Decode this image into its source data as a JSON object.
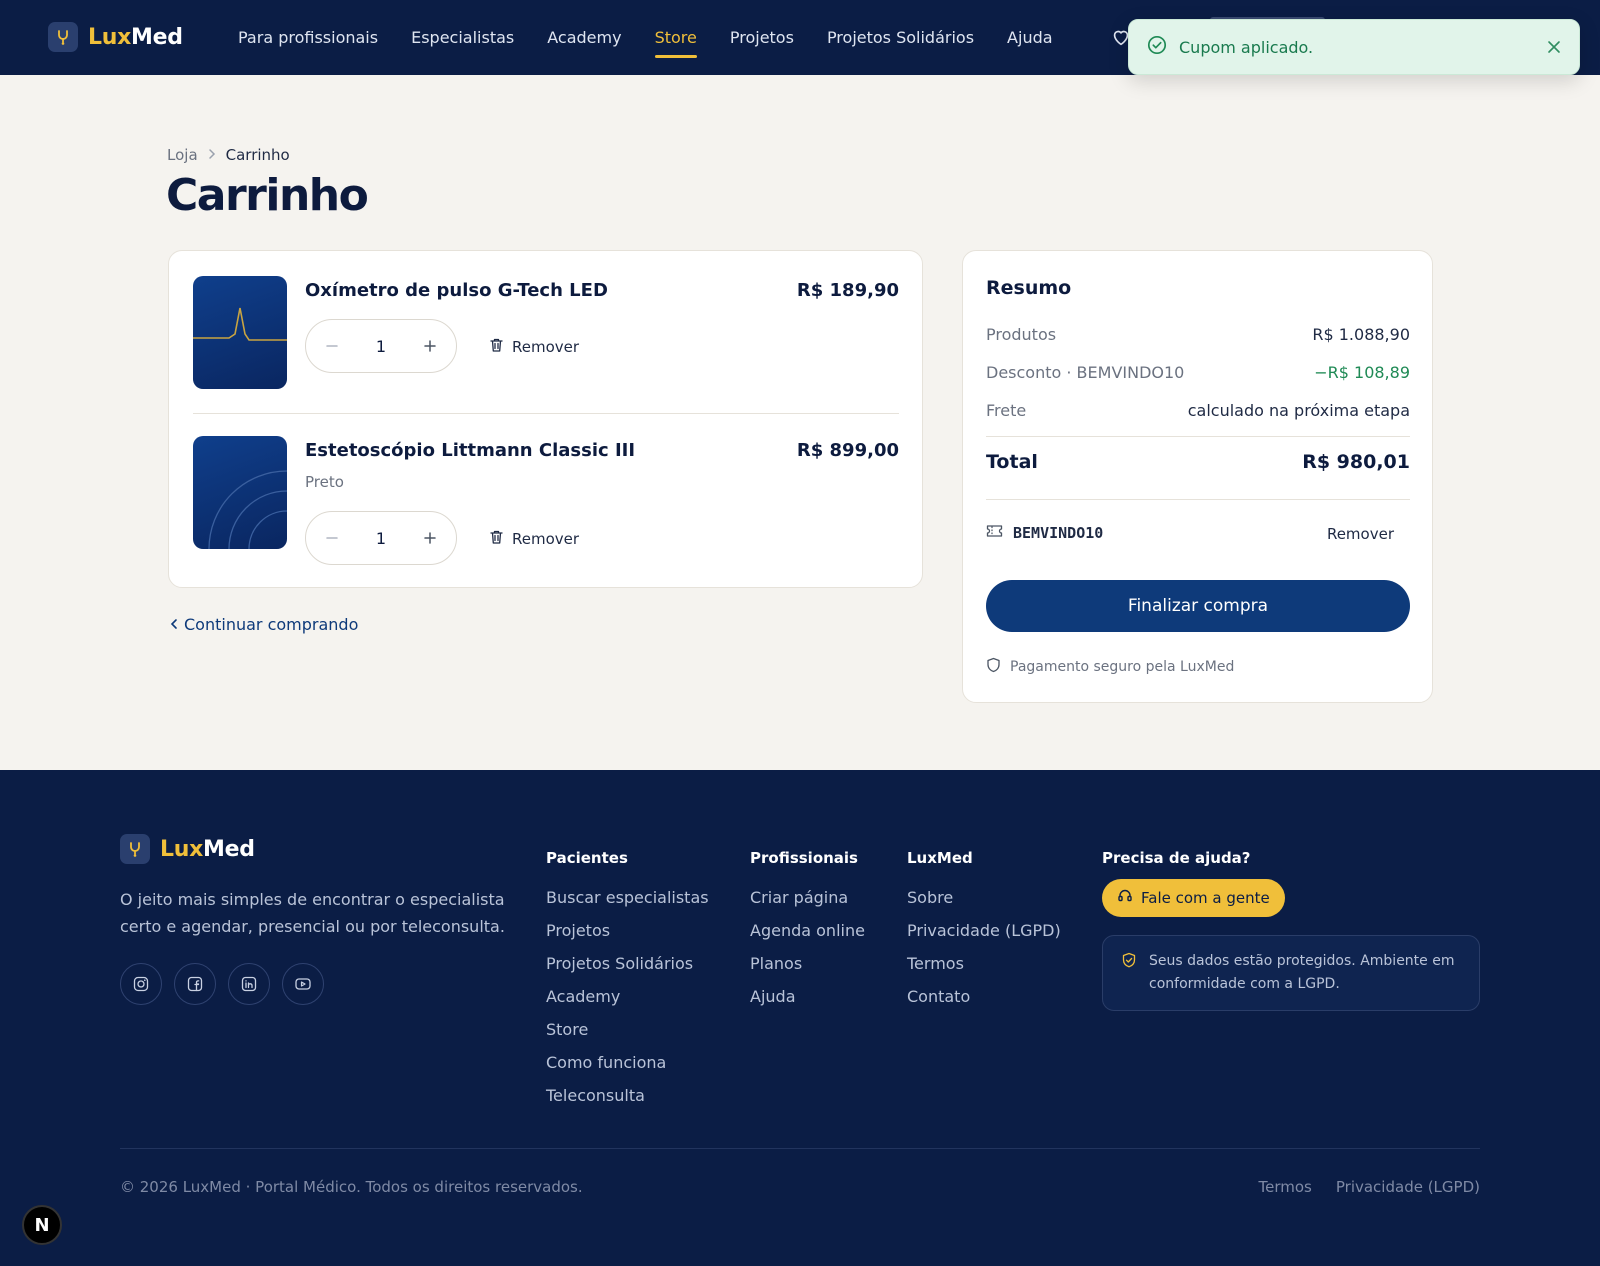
{
  "brand": {
    "lux": "Lux",
    "med": "Med"
  },
  "nav": {
    "items": [
      {
        "label": "Para profissionais"
      },
      {
        "label": "Especialistas"
      },
      {
        "label": "Academy"
      },
      {
        "label": "Store",
        "active": true
      },
      {
        "label": "Projetos"
      },
      {
        "label": "Projetos Solidários"
      },
      {
        "label": "Ajuda"
      }
    ]
  },
  "toast": {
    "message": "Cupom aplicado.",
    "icon": "check-circle-icon"
  },
  "breadcrumb": {
    "parent": "Loja",
    "current": "Carrinho"
  },
  "page": {
    "title": "Carrinho"
  },
  "cart": {
    "items": [
      {
        "name": "Oxímetro de pulso G-Tech LED",
        "price": "R$ 189,90",
        "variant": "",
        "quantity": "1",
        "remove_label": "Remover"
      },
      {
        "name": "Estetoscópio Littmann Classic III",
        "price": "R$ 899,00",
        "variant": "Preto",
        "quantity": "1",
        "remove_label": "Remover"
      }
    ],
    "continue_label": "Continuar comprando"
  },
  "summary": {
    "title": "Resumo",
    "products_label": "Produtos",
    "products_value": "R$ 1.088,90",
    "discount_label": "Desconto · BEMVINDO10",
    "discount_value": "−R$ 108,89",
    "shipping_label": "Frete",
    "shipping_value": "calculado na próxima etapa",
    "total_label": "Total",
    "total_value": "R$ 980,01",
    "coupon_code": "BEMVINDO10",
    "coupon_remove": "Remover",
    "checkout_label": "Finalizar compra",
    "secure_note": "Pagamento seguro pela LuxMed"
  },
  "footer": {
    "tagline": "O jeito mais simples de encontrar o especialista certo e agendar, presencial ou por teleconsulta.",
    "socials": [
      "instagram-icon",
      "facebook-icon",
      "linkedin-icon",
      "youtube-icon"
    ],
    "pacientes": {
      "heading": "Pacientes",
      "links": [
        "Buscar especialistas",
        "Projetos",
        "Projetos Solidários",
        "Academy",
        "Store",
        "Como funciona",
        "Teleconsulta"
      ]
    },
    "profissionais": {
      "heading": "Profissionais",
      "links": [
        "Criar página",
        "Agenda online",
        "Planos",
        "Ajuda"
      ]
    },
    "luxmed": {
      "heading": "LuxMed",
      "links": [
        "Sobre",
        "Privacidade (LGPD)",
        "Termos",
        "Contato"
      ]
    },
    "help": {
      "heading": "Precisa de ajuda?",
      "button": "Fale com a gente",
      "lgpd_note": "Seus dados estão protegidos. Ambiente em conformidade com a LGPD."
    },
    "copyright": "© 2026 LuxMed · Portal Médico. Todos os direitos reservados.",
    "legal": [
      "Termos",
      "Privacidade (LGPD)"
    ]
  },
  "colors": {
    "navy": "#0b1d45",
    "accent": "#f0bf3a",
    "primary": "#0e3a7a",
    "success": "#1f8a55"
  }
}
